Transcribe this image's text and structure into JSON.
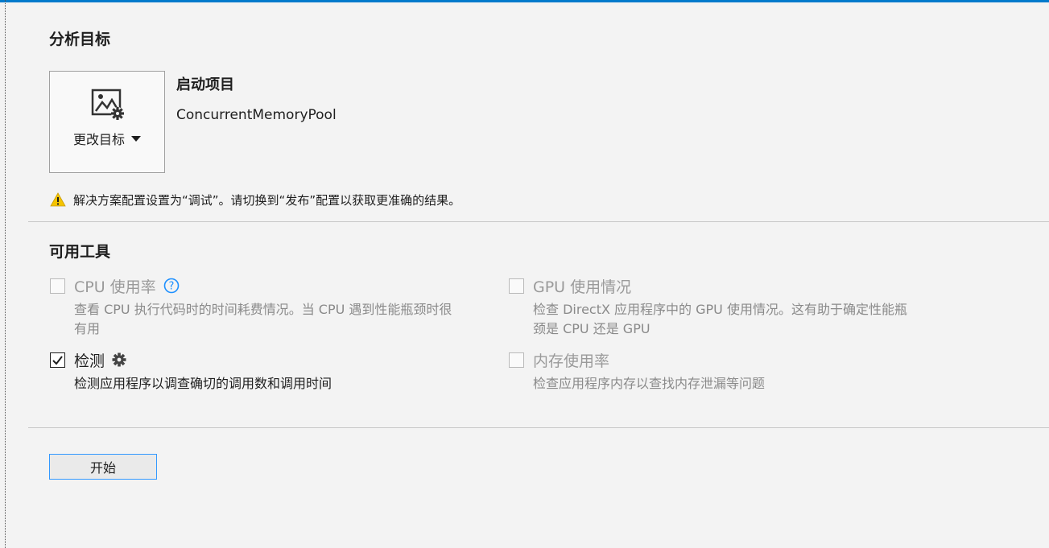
{
  "target_section": {
    "title": "分析目标",
    "change_target_label": "更改目标",
    "startup_title": "启动项目",
    "project_name": "ConcurrentMemoryPool"
  },
  "warning": {
    "icon": "warning-icon",
    "text": "解决方案配置设置为“调试”。请切换到“发布”配置以获取更准确的结果。"
  },
  "tools_section": {
    "title": "可用工具",
    "tools": [
      {
        "name": "CPU 使用率",
        "checked": false,
        "icon": "help-icon",
        "desc_line1": "查看 CPU 执行代码时的时间耗费情况。当 CPU 遇到性能瓶颈时很",
        "desc_line2": "有用"
      },
      {
        "name": "GPU 使用情况",
        "checked": false,
        "desc_line1": "检查 DirectX 应用程序中的 GPU 使用情况。这有助于确定性能瓶",
        "desc_line2": "颈是 CPU 还是 GPU"
      },
      {
        "name": "检测",
        "checked": true,
        "icon": "gear-icon",
        "desc_line1": "检测应用程序以调查确切的调用数和调用时间"
      },
      {
        "name": "内存使用率",
        "checked": false,
        "desc_line1": "检查应用程序内存以查找内存泄漏等问题"
      }
    ]
  },
  "start_button": {
    "label": "开始"
  },
  "colors": {
    "accent": "#007acc",
    "focus_border": "#3399ff",
    "help": "#1e90ff",
    "warning": "#f5c400"
  }
}
